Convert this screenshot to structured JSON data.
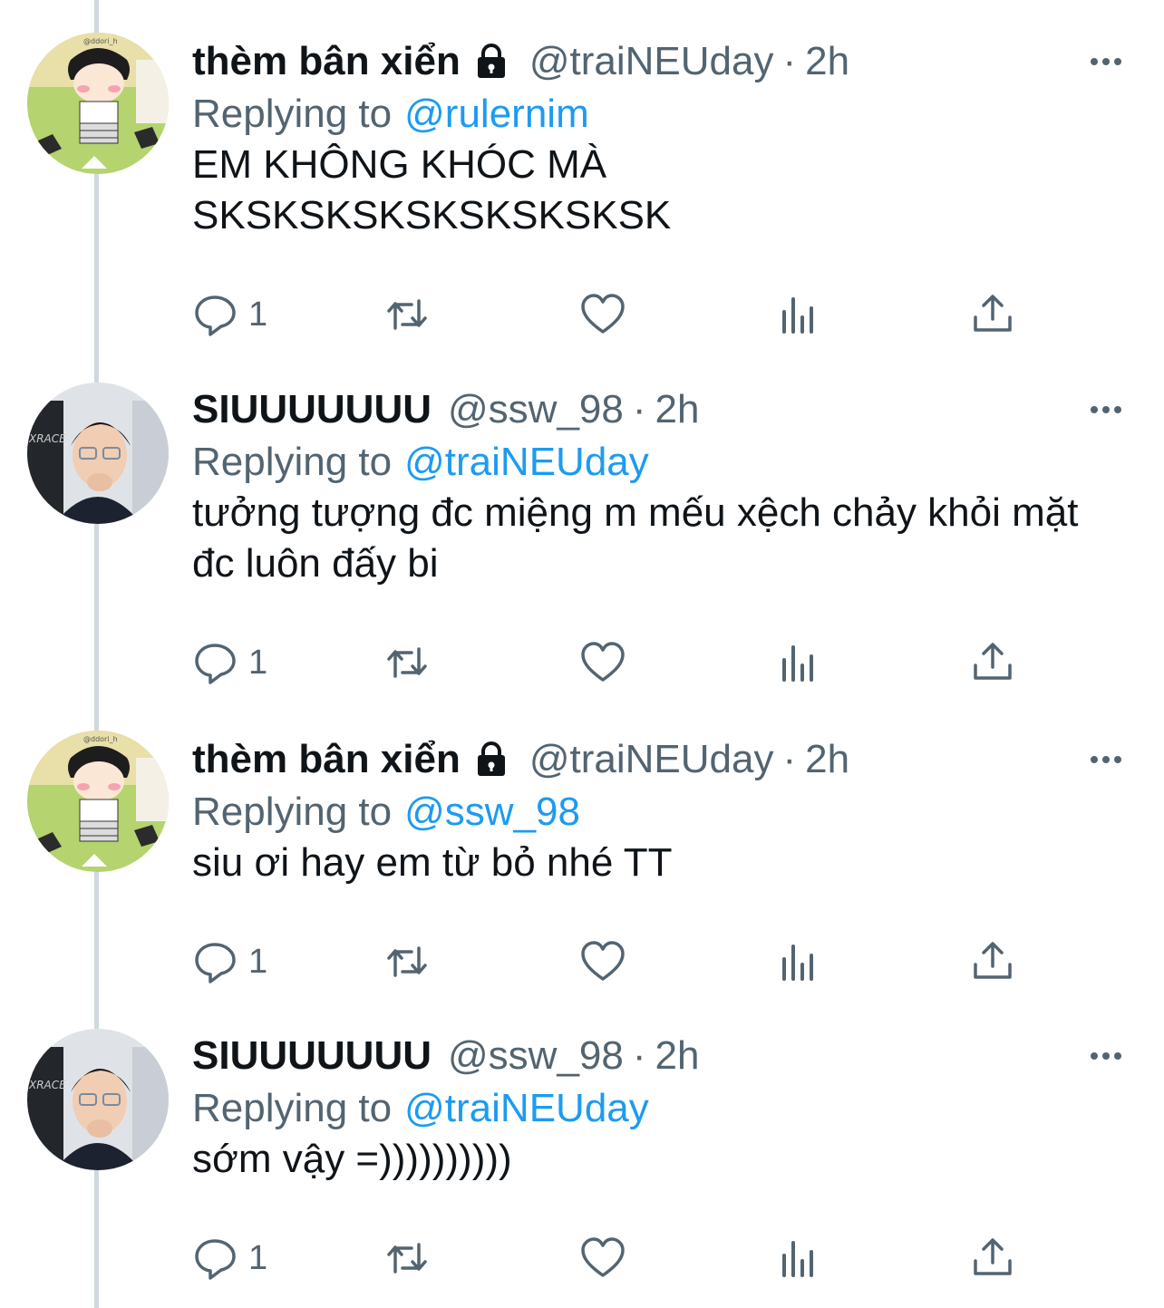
{
  "colors": {
    "text": "#0f1419",
    "secondary": "#536471",
    "link": "#1d9bf0",
    "thread_line": "#cfd9de"
  },
  "tweets": [
    {
      "name": "thèm bân xiển",
      "locked": true,
      "handle": "@traiNEUday",
      "separator": "·",
      "time": "2h",
      "replying_label": "Replying to",
      "replying_to": "@rulernim",
      "text": "EM KHÔNG KHÓC MÀ SKSKSKSKSKSKSKSKSK",
      "reply_count": "1",
      "icons": [
        "reply-icon",
        "retweet-icon",
        "like-icon",
        "analytics-icon",
        "share-icon",
        "more-icon",
        "lock-icon"
      ]
    },
    {
      "name": "SIUUUUUUU",
      "locked": false,
      "handle": "@ssw_98",
      "separator": "·",
      "time": "2h",
      "replying_label": "Replying to",
      "replying_to": "@traiNEUday",
      "text": "tưởng tượng đc miệng m mếu xệch chảy khỏi mặt đc luôn đấy bi",
      "reply_count": "1",
      "icons": [
        "reply-icon",
        "retweet-icon",
        "like-icon",
        "analytics-icon",
        "share-icon",
        "more-icon"
      ]
    },
    {
      "name": "thèm bân xiển",
      "locked": true,
      "handle": "@traiNEUday",
      "separator": "·",
      "time": "2h",
      "replying_label": "Replying to",
      "replying_to": "@ssw_98",
      "text": "siu ơi hay em từ bỏ nhé TT",
      "reply_count": "1",
      "icons": [
        "reply-icon",
        "retweet-icon",
        "like-icon",
        "analytics-icon",
        "share-icon",
        "more-icon",
        "lock-icon"
      ]
    },
    {
      "name": "SIUUUUUUU",
      "locked": false,
      "handle": "@ssw_98",
      "separator": "·",
      "time": "2h",
      "replying_label": "Replying to",
      "replying_to": "@traiNEUday",
      "text": "sớm vậy =))))))))))",
      "reply_count": "1",
      "icons": [
        "reply-icon",
        "retweet-icon",
        "like-icon",
        "analytics-icon",
        "share-icon",
        "more-icon"
      ]
    }
  ]
}
